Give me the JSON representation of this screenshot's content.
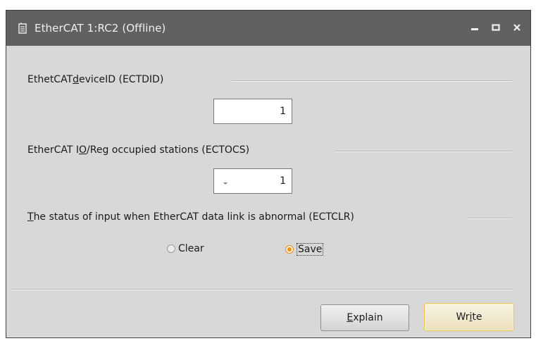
{
  "window": {
    "title": "EtherCAT 1:RC2  (Offline)"
  },
  "groups": {
    "device_id": {
      "label_pre": "EthetCAT ",
      "label_key": "d",
      "label_post": "eviceID (ECTDID)",
      "value": "1"
    },
    "occupied_stations": {
      "label_pre": "EtherCAT I",
      "label_key": "O",
      "label_post": "/Reg occupied stations (ECTOCS)",
      "value": "1"
    },
    "input_status": {
      "label_key": "T",
      "label_post": "he status of input when EtherCAT data link is abnormal (ECTCLR)",
      "options": {
        "clear": "Clear",
        "save": "Save"
      },
      "selected": "Save"
    }
  },
  "buttons": {
    "explain_key": "E",
    "explain_rest": "xplain",
    "write_pre": "Wr",
    "write_key": "i",
    "write_post": "te"
  }
}
